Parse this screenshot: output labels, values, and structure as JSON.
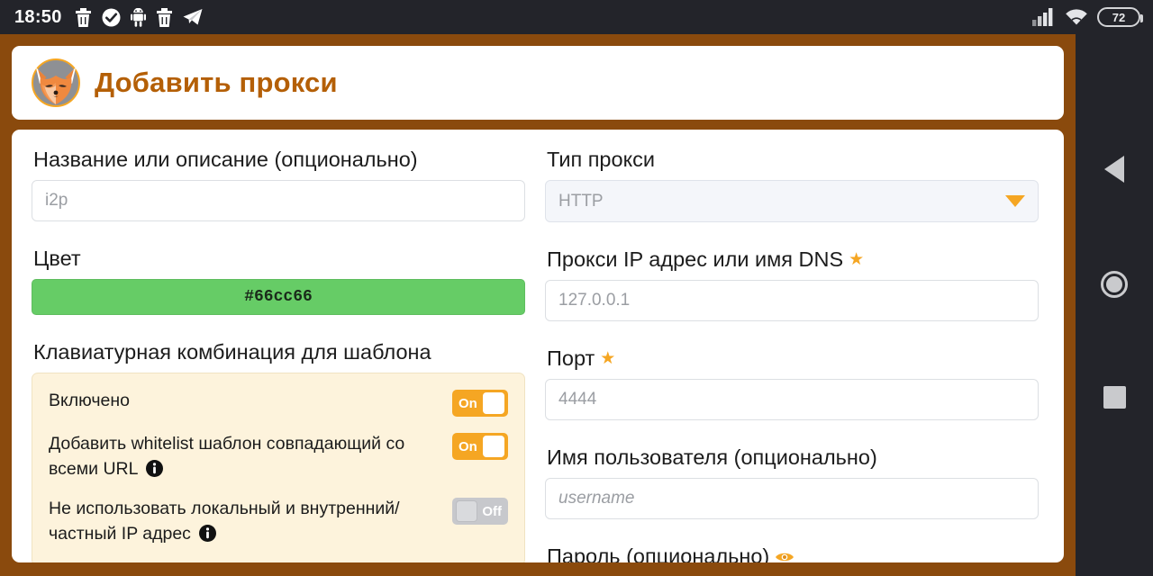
{
  "status_bar": {
    "clock": "18:50",
    "left_icons": [
      "trash-icon",
      "check-circle-icon",
      "android-robot-icon",
      "trash-icon",
      "telegram-icon"
    ],
    "right_icons": [
      "signal-bars-icon",
      "wifi-icon"
    ],
    "battery_level": "72"
  },
  "header": {
    "logo": "fox-logo",
    "title": "Добавить прокси"
  },
  "left_column": {
    "name_label": "Название или описание (опционально)",
    "name_placeholder": "i2p",
    "color_label": "Цвет",
    "color_value": "#66cc66",
    "color_hex": "#66cc66",
    "shortcut_label": "Клавиатурная комбинация для шаблона",
    "toggles": [
      {
        "text": "Включено",
        "state_label": "On",
        "state": "on",
        "has_info": false
      },
      {
        "text": "Добавить whitelist шаблон совпадающий со всеми URL",
        "state_label": "On",
        "state": "on",
        "has_info": true
      },
      {
        "text": "Не использовать локальный и внутренний/частный IP адрес",
        "state_label": "Off",
        "state": "off",
        "has_info": true
      }
    ]
  },
  "right_column": {
    "proxy_type_label": "Тип прокси",
    "proxy_type_value": "HTTP",
    "ip_label": "Прокси IP адрес или имя DNS",
    "ip_placeholder": "127.0.0.1",
    "port_label": "Порт",
    "port_placeholder": "4444",
    "username_label": "Имя пользователя (опционально)",
    "username_placeholder": "username",
    "password_label": "Пароль (опционально)"
  },
  "nav_bar": {
    "back": "back-triangle-icon",
    "home": "home-circle-icon",
    "recents": "recents-square-icon"
  },
  "colors": {
    "accent": "#f5a623",
    "brand_brown": "#8a4a0d",
    "title": "#b45f06",
    "panel_cream": "#fdf3dc"
  }
}
